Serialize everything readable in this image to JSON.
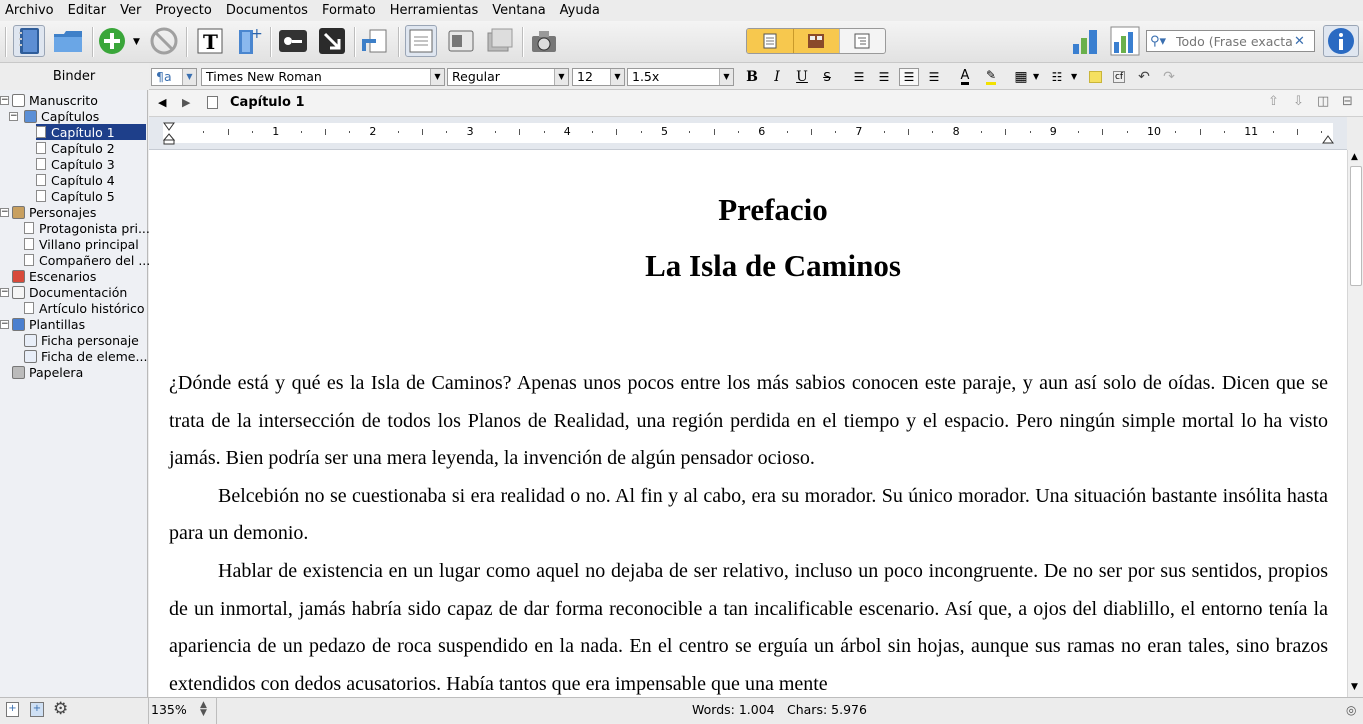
{
  "menu": [
    "Archivo",
    "Editar",
    "Ver",
    "Proyecto",
    "Documentos",
    "Formato",
    "Herramientas",
    "Ventana",
    "Ayuda"
  ],
  "search": {
    "placeholder": "Todo (Frase exacta)"
  },
  "binder": {
    "title": "Binder",
    "items": [
      {
        "label": "Manuscrito",
        "level": 0,
        "icon": "manuscript-icon"
      },
      {
        "label": "Capítulos",
        "level": 1,
        "icon": "folder-icon"
      },
      {
        "label": "Capítulo 1",
        "level": 2,
        "icon": "document-icon",
        "selected": true
      },
      {
        "label": "Capítulo 2",
        "level": 2,
        "icon": "document-icon"
      },
      {
        "label": "Capítulo 3",
        "level": 2,
        "icon": "document-icon"
      },
      {
        "label": "Capítulo 4",
        "level": 2,
        "icon": "document-icon"
      },
      {
        "label": "Capítulo 5",
        "level": 2,
        "icon": "document-icon"
      },
      {
        "label": "Personajes",
        "level": 0,
        "icon": "characters-icon"
      },
      {
        "label": "Protagonista pri...",
        "level": 1,
        "icon": "document-icon"
      },
      {
        "label": "Villano principal",
        "level": 1,
        "icon": "document-icon"
      },
      {
        "label": "Compañero del ...",
        "level": 1,
        "icon": "document-icon"
      },
      {
        "label": "Escenarios",
        "level": 0,
        "icon": "places-icon"
      },
      {
        "label": "Documentación",
        "level": 0,
        "icon": "research-icon"
      },
      {
        "label": "Artículo histórico",
        "level": 1,
        "icon": "document-icon"
      },
      {
        "label": "Plantillas",
        "level": 0,
        "icon": "templates-icon"
      },
      {
        "label": "Ficha personaje",
        "level": 1,
        "icon": "template-doc-icon"
      },
      {
        "label": "Ficha de eleme...",
        "level": 1,
        "icon": "template-doc-icon"
      },
      {
        "label": "Papelera",
        "level": 0,
        "icon": "trash-icon"
      }
    ]
  },
  "format": {
    "style": "¶a",
    "font": "Times New Roman",
    "weight": "Regular",
    "size": "12",
    "spacing": "1.5x"
  },
  "editor": {
    "doc_title": "Capítulo 1",
    "ruler_numbers": [
      "1",
      "2",
      "3",
      "4",
      "5",
      "6",
      "7",
      "8",
      "9",
      "10",
      "11"
    ],
    "heading1": "Prefacio",
    "heading2": "La Isla de Caminos",
    "paragraphs": [
      "¿Dónde está y qué es la Isla de Caminos? Apenas unos pocos entre los más sabios conocen este paraje, y aun así solo de oídas. Dicen que se trata de la intersección de todos los Planos de Realidad, una región perdida en el tiempo y el espacio. Pero ningún simple mortal lo ha visto jamás. Bien podría ser una mera leyenda, la invención de algún pensador ocioso.",
      "Belcebión no se cuestionaba si era realidad o no. Al fin y al cabo, era su morador. Su único morador. Una situación bastante insólita hasta para un demonio.",
      "Hablar de existencia en un lugar como aquel no dejaba de ser relativo, incluso un poco incongruente. De no ser por sus sentidos, propios de un inmortal, jamás habría sido capaz de dar forma reconocible a tan incalificable escenario. Así que, a ojos del diablillo, el entorno tenía la apariencia de un pedazo de roca suspendido en la nada. En el centro se erguía un árbol sin hojas, aunque sus ramas no eran tales, sino brazos extendidos con dedos acusatorios. Había tantos que era impensable que una mente"
    ]
  },
  "status": {
    "zoom": "135%",
    "words": "Words: 1.004",
    "chars": "Chars: 5.976"
  }
}
